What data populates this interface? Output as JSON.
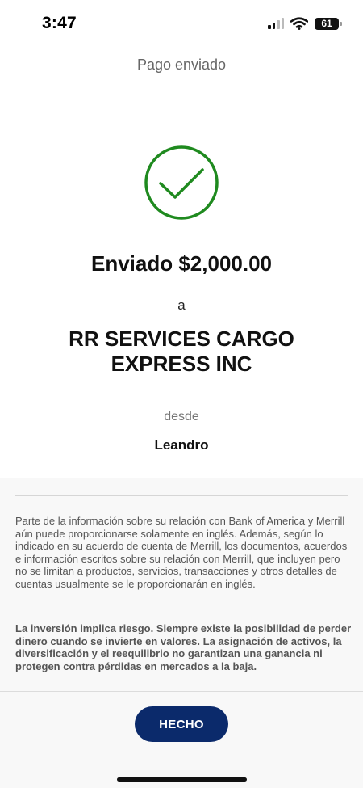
{
  "status_bar": {
    "time": "3:47",
    "battery": "61",
    "icons": [
      "signal-icon",
      "wifi-icon",
      "battery-icon"
    ]
  },
  "header": {
    "title": "Pago enviado"
  },
  "confirmation": {
    "icon": "checkmark-circle-icon",
    "icon_color": "#1f8a1f",
    "sent_amount": "Enviado $2,000.00",
    "to_label": "a",
    "recipient": "RR SERVICES CARGO EXPRESS INC",
    "from_label": "desde",
    "account_name": "Leandro"
  },
  "disclosures": {
    "language_notice": "Parte de la información sobre su relación con Bank of America y Merrill aún puede proporcionarse solamente en inglés. Además, según lo indicado en su acuerdo de cuenta de Merrill, los documentos, acuerdos e información escritos sobre su relación con Merrill, que incluyen pero no se limitan a productos, servicios, transacciones y otros detalles de cuentas usualmente se le proporcionarán en inglés.",
    "risk_notice": "La inversión implica riesgo. Siempre existe la posibilidad de perder dinero cuando se invierte en valores. La asignación de activos, la diversificación y el reequilibrio no garantizan una ganancia ni protegen contra pérdidas en mercados a la baja."
  },
  "footer": {
    "done_label": "HECHO",
    "button_color": "#0b2a6b"
  }
}
